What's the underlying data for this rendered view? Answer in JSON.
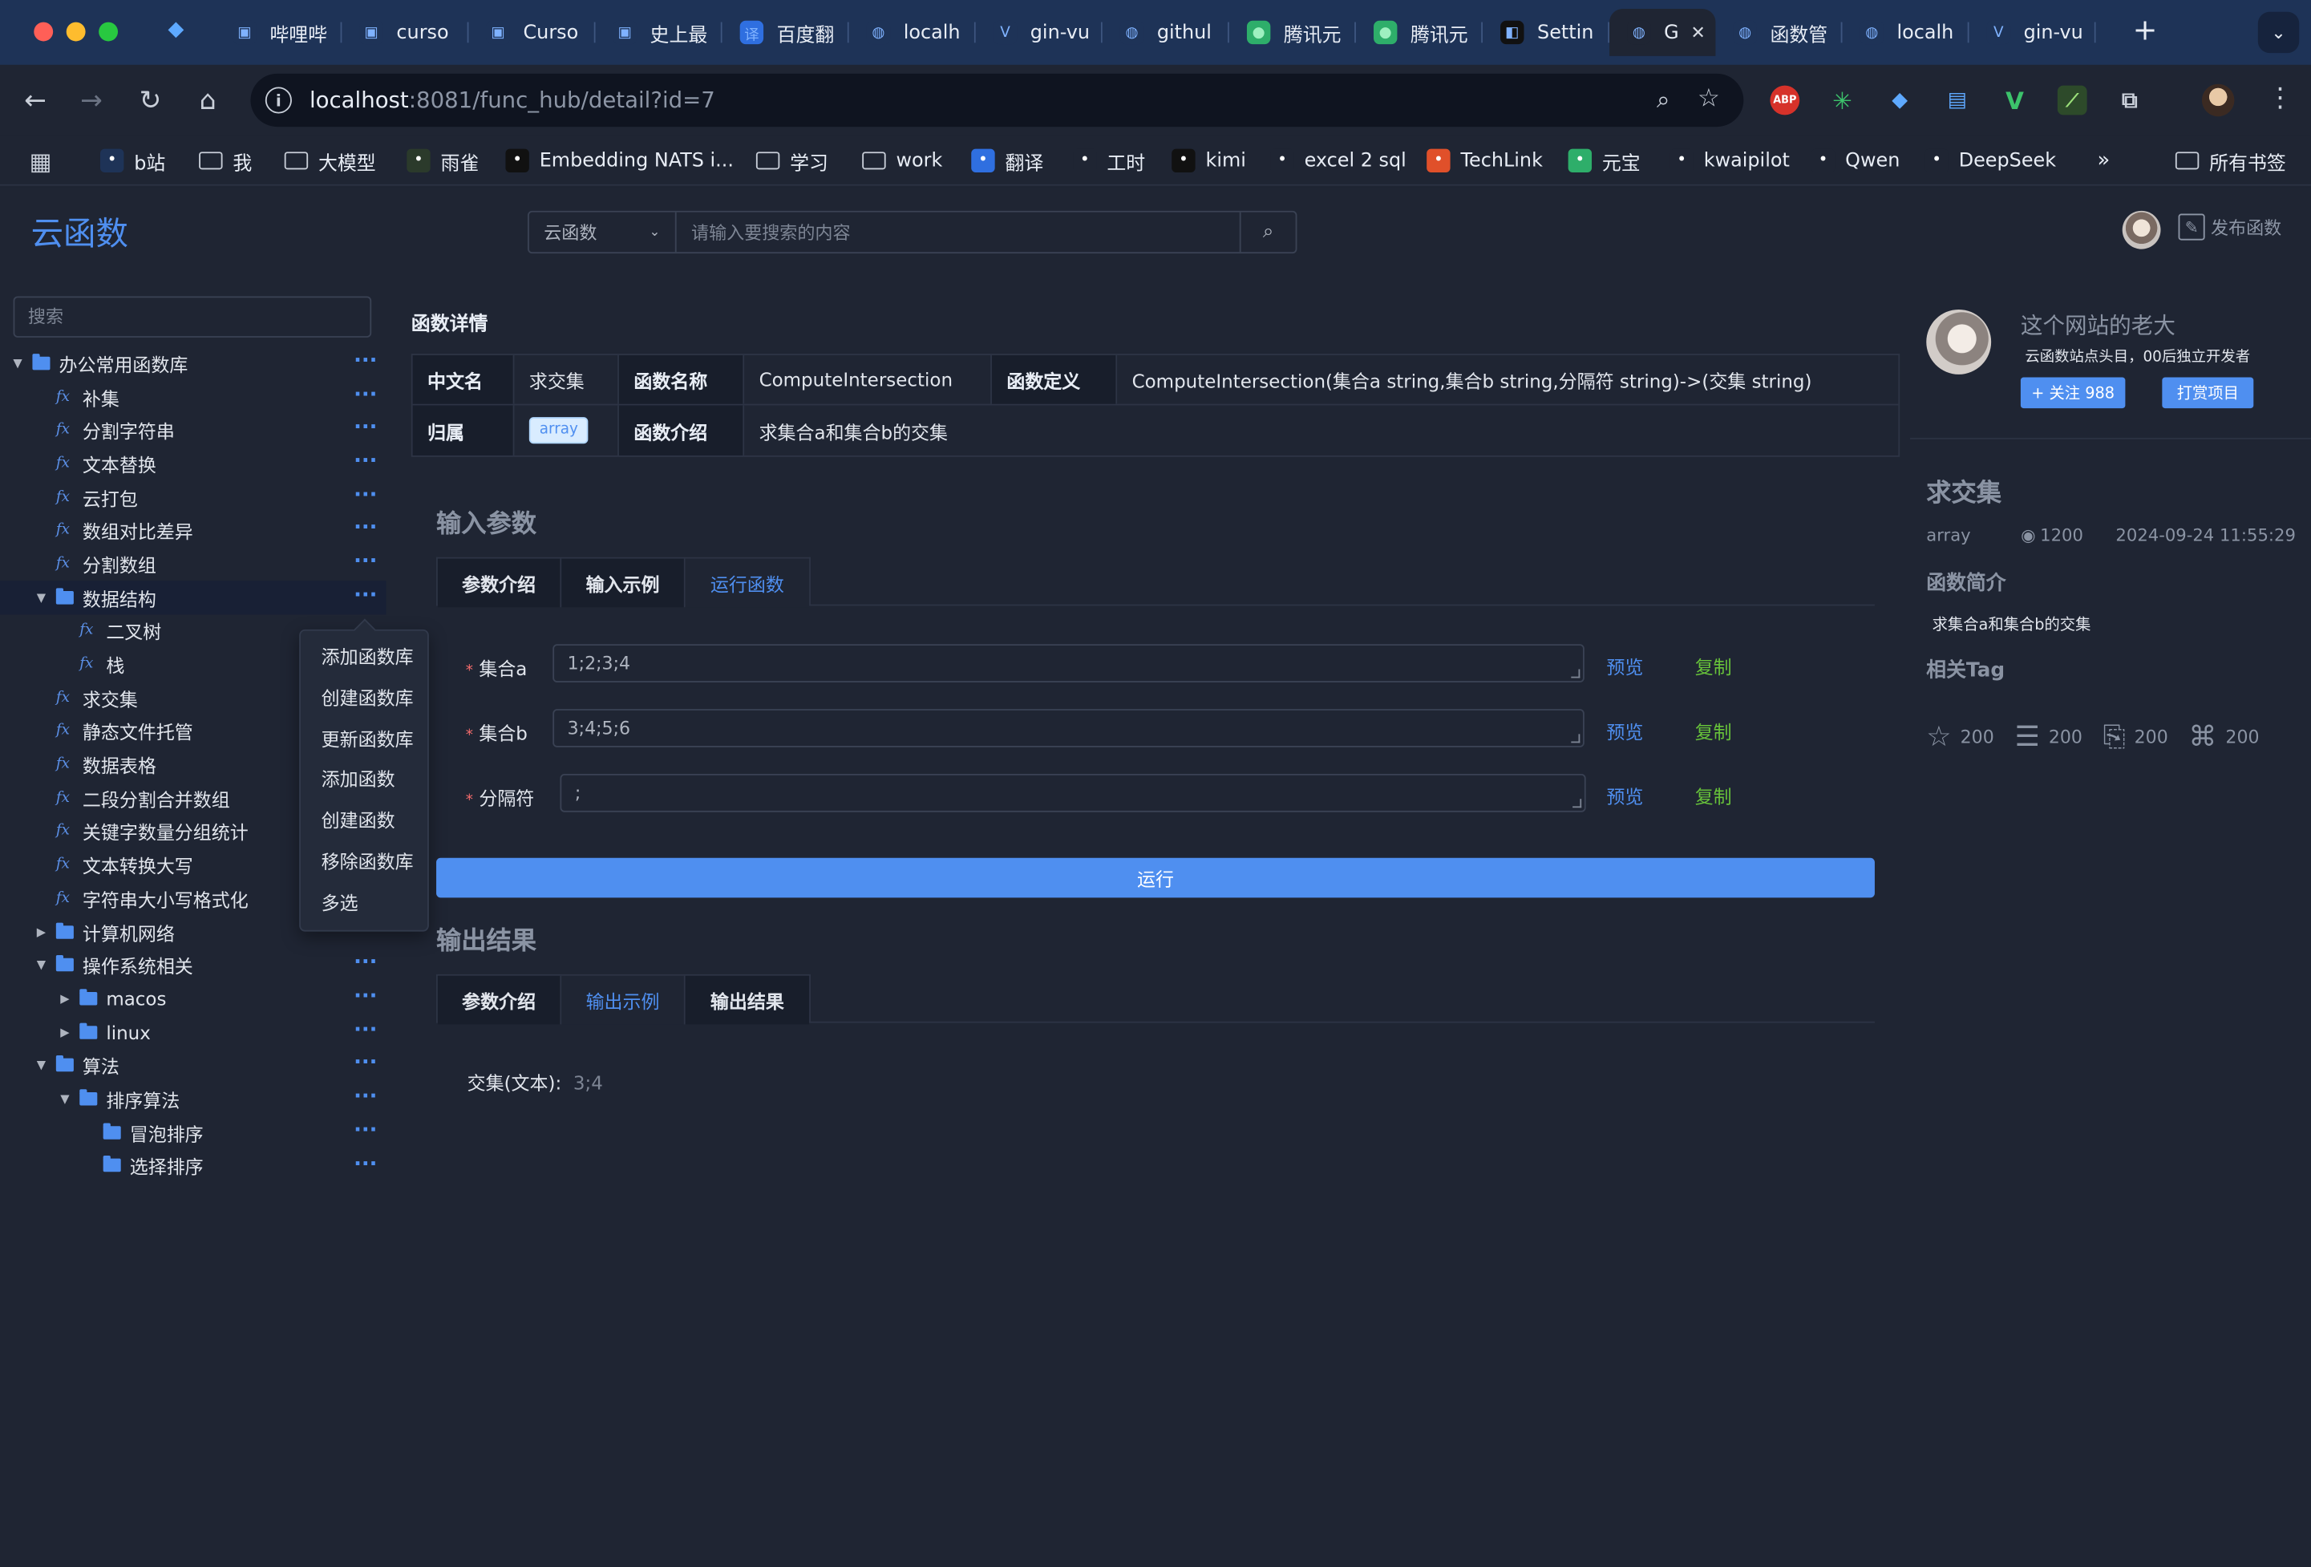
{
  "browser": {
    "tabs": [
      {
        "label": "哔哩哔",
        "icon": "bilibili-icon",
        "color": "#1e3357"
      },
      {
        "label": "curso",
        "icon": "bilibili-icon",
        "color": "#1e3357"
      },
      {
        "label": "Curso",
        "icon": "bilibili-icon",
        "color": "#1e3357"
      },
      {
        "label": "史上最",
        "icon": "bilibili-icon",
        "color": "#1e3357"
      },
      {
        "label": "百度翻",
        "icon": "translate-icon",
        "color": "#2f6fe0"
      },
      {
        "label": "localh",
        "icon": "globe-icon",
        "color": "#1e3357"
      },
      {
        "label": "gin-vu",
        "icon": "vue-icon",
        "color": "#1e3357"
      },
      {
        "label": "githul",
        "icon": "globe-icon",
        "color": "#1e3357"
      },
      {
        "label": "腾讯元",
        "icon": "yuanbao-icon",
        "color": "#2eae6a"
      },
      {
        "label": "腾讯元",
        "icon": "yuanbao-icon",
        "color": "#2eae6a"
      },
      {
        "label": "Settin",
        "icon": "cursor-icon",
        "color": "#111111"
      },
      {
        "label": "G",
        "icon": "globe-icon",
        "color": "#1f2533",
        "active": true
      },
      {
        "label": "函数管",
        "icon": "globe-icon",
        "color": "#1e3357"
      },
      {
        "label": "localh",
        "icon": "globe-icon",
        "color": "#1e3357"
      },
      {
        "label": "gin-vu",
        "icon": "vue-icon",
        "color": "#1e3357"
      }
    ],
    "url_host": "localhost",
    "url_rest": ":8081/func_hub/detail?id=7",
    "bookmarks": [
      {
        "label": "b站",
        "type": "icon"
      },
      {
        "label": "我",
        "type": "folder"
      },
      {
        "label": "大模型",
        "type": "folder"
      },
      {
        "label": "雨雀",
        "type": "icon"
      },
      {
        "label": "Embedding NATS i...",
        "type": "icon"
      },
      {
        "label": "学习",
        "type": "folder"
      },
      {
        "label": "work",
        "type": "folder"
      },
      {
        "label": "翻译",
        "type": "icon"
      },
      {
        "label": "工时",
        "type": "icon"
      },
      {
        "label": "kimi",
        "type": "icon"
      },
      {
        "label": "excel 2 sql",
        "type": "icon"
      },
      {
        "label": "TechLink",
        "type": "icon"
      },
      {
        "label": "元宝",
        "type": "icon"
      },
      {
        "label": "kwaipilot",
        "type": "icon"
      },
      {
        "label": "Qwen",
        "type": "icon"
      },
      {
        "label": "DeepSeek",
        "type": "icon"
      }
    ],
    "all_bookmarks": "所有书签",
    "ext_abp": "ABP"
  },
  "app": {
    "brand": "云函数",
    "search_scope": "云函数",
    "search_placeholder": "请输入要搜索的内容",
    "publish": "发布函数",
    "sidebar_search_placeholder": "搜索",
    "tree": [
      {
        "label": "办公常用函数库",
        "kind": "folder",
        "depth": 0,
        "caret": "down",
        "more": true
      },
      {
        "label": "补集",
        "kind": "fx",
        "depth": 1,
        "more": true
      },
      {
        "label": "分割字符串",
        "kind": "fx",
        "depth": 1,
        "more": true
      },
      {
        "label": "文本替换",
        "kind": "fx",
        "depth": 1,
        "more": true
      },
      {
        "label": "云打包",
        "kind": "fx",
        "depth": 1,
        "more": true
      },
      {
        "label": "数组对比差异",
        "kind": "fx",
        "depth": 1,
        "more": true
      },
      {
        "label": "分割数组",
        "kind": "fx",
        "depth": 1,
        "more": true
      },
      {
        "label": "数据结构",
        "kind": "folder",
        "depth": 1,
        "caret": "down",
        "more": true,
        "highlight": true
      },
      {
        "label": "二叉树",
        "kind": "fx",
        "depth": 2
      },
      {
        "label": "栈",
        "kind": "fx",
        "depth": 2
      },
      {
        "label": "求交集",
        "kind": "fx",
        "depth": 1
      },
      {
        "label": "静态文件托管",
        "kind": "fx",
        "depth": 1
      },
      {
        "label": "数据表格",
        "kind": "fx",
        "depth": 1
      },
      {
        "label": "二段分割合并数组",
        "kind": "fx",
        "depth": 1
      },
      {
        "label": "关键字数量分组统计",
        "kind": "fx",
        "depth": 1
      },
      {
        "label": "文本转换大写",
        "kind": "fx",
        "depth": 1
      },
      {
        "label": "字符串大小写格式化",
        "kind": "fx",
        "depth": 1
      },
      {
        "label": "计算机网络",
        "kind": "folder",
        "depth": 1,
        "caret": "right",
        "more": true
      },
      {
        "label": "操作系统相关",
        "kind": "folder",
        "depth": 1,
        "caret": "down",
        "more": true
      },
      {
        "label": "macos",
        "kind": "folder",
        "depth": 2,
        "caret": "right",
        "more": true
      },
      {
        "label": "linux",
        "kind": "folder",
        "depth": 2,
        "caret": "right",
        "more": true
      },
      {
        "label": "算法",
        "kind": "folder",
        "depth": 1,
        "caret": "down",
        "more": true
      },
      {
        "label": "排序算法",
        "kind": "folder",
        "depth": 2,
        "caret": "down",
        "more": true
      },
      {
        "label": "冒泡排序",
        "kind": "folder",
        "depth": 3,
        "more": true
      },
      {
        "label": "选择排序",
        "kind": "folder",
        "depth": 3,
        "more": true
      }
    ],
    "context_menu": [
      "添加函数库",
      "创建函数库",
      "更新函数库",
      "添加函数",
      "创建函数",
      "移除函数库",
      "多选"
    ],
    "detail": {
      "title": "函数详情",
      "cn_name_label": "中文名",
      "cn_name": "求交集",
      "fn_name_label": "函数名称",
      "fn_name": "ComputeIntersection",
      "fn_def_label": "函数定义",
      "fn_def": "ComputeIntersection(集合a string,集合b string,分隔符 string)->(交集 string)",
      "owner_label": "归属",
      "owner_tag": "array",
      "intro_label": "函数介绍",
      "intro": "求集合a和集合b的交集"
    },
    "input": {
      "title": "输入参数",
      "tabs": [
        "参数介绍",
        "输入示例",
        "运行函数"
      ],
      "active_tab": 2,
      "fields": [
        {
          "label": "集合a",
          "value": "1;2;3;4"
        },
        {
          "label": "集合b",
          "value": "3;4;5;6"
        },
        {
          "label": "分隔符",
          "value": ";"
        }
      ],
      "preview": "预览",
      "copy": "复制",
      "run": "运行"
    },
    "output": {
      "title": "输出结果",
      "tabs": [
        "参数介绍",
        "输出示例",
        "输出结果"
      ],
      "active_tab": 1,
      "result_label": "交集(文本):",
      "result_value": "3;4"
    },
    "author": {
      "name": "这个网站的老大",
      "bio": "云函数站点头目，00后独立开发者",
      "follow": "+ 关注 988",
      "reward": "打赏项目"
    },
    "summary": {
      "title": "求交集",
      "tag": "array",
      "views": "1200",
      "time": "2024-09-24 11:55:29",
      "intro_heading": "函数简介",
      "intro": "求集合a和集合b的交集",
      "tag_heading": "相关Tag",
      "stats": [
        {
          "icon": "star-icon",
          "value": "200"
        },
        {
          "icon": "database-icon",
          "value": "200"
        },
        {
          "icon": "bookmark-icon",
          "value": "200"
        },
        {
          "icon": "chip-icon",
          "value": "200"
        }
      ]
    }
  },
  "colors": {
    "accent": "#4f8ff0",
    "success": "#67c23a",
    "danger": "#f56c6c",
    "background": "#1f2533",
    "tabstrip": "#1e3357"
  }
}
